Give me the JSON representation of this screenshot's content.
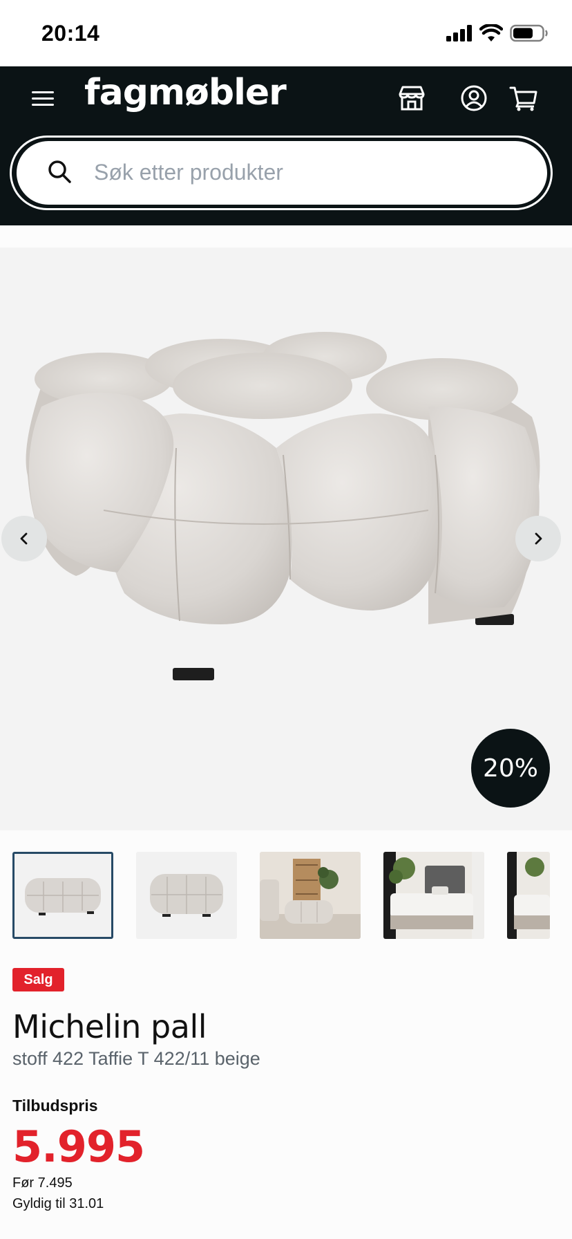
{
  "status_bar": {
    "time": "20:14"
  },
  "header": {
    "logo": "fagmøbler",
    "icons": [
      "menu-icon",
      "store-icon",
      "account-icon",
      "cart-icon"
    ],
    "search_placeholder": "Søk etter produkter"
  },
  "gallery": {
    "discount": "20%",
    "thumbnails": [
      "thumb-ottoman-front",
      "thumb-ottoman-side",
      "thumb-living-room",
      "thumb-bedroom",
      "thumb-bedroom-2"
    ],
    "active_index": 0
  },
  "product": {
    "tag": "Salg",
    "name": "Michelin pall",
    "variant": "stoff 422 Taffie T 422/11 beige",
    "price_label": "Tilbudspris",
    "price": "5.995",
    "before_price": "Før 7.495",
    "valid_until": "Gyldig til 31.01"
  },
  "colors": {
    "header_bg": "#0b1315",
    "sale_red": "#e2222b",
    "active_thumb_border": "#274a66"
  }
}
